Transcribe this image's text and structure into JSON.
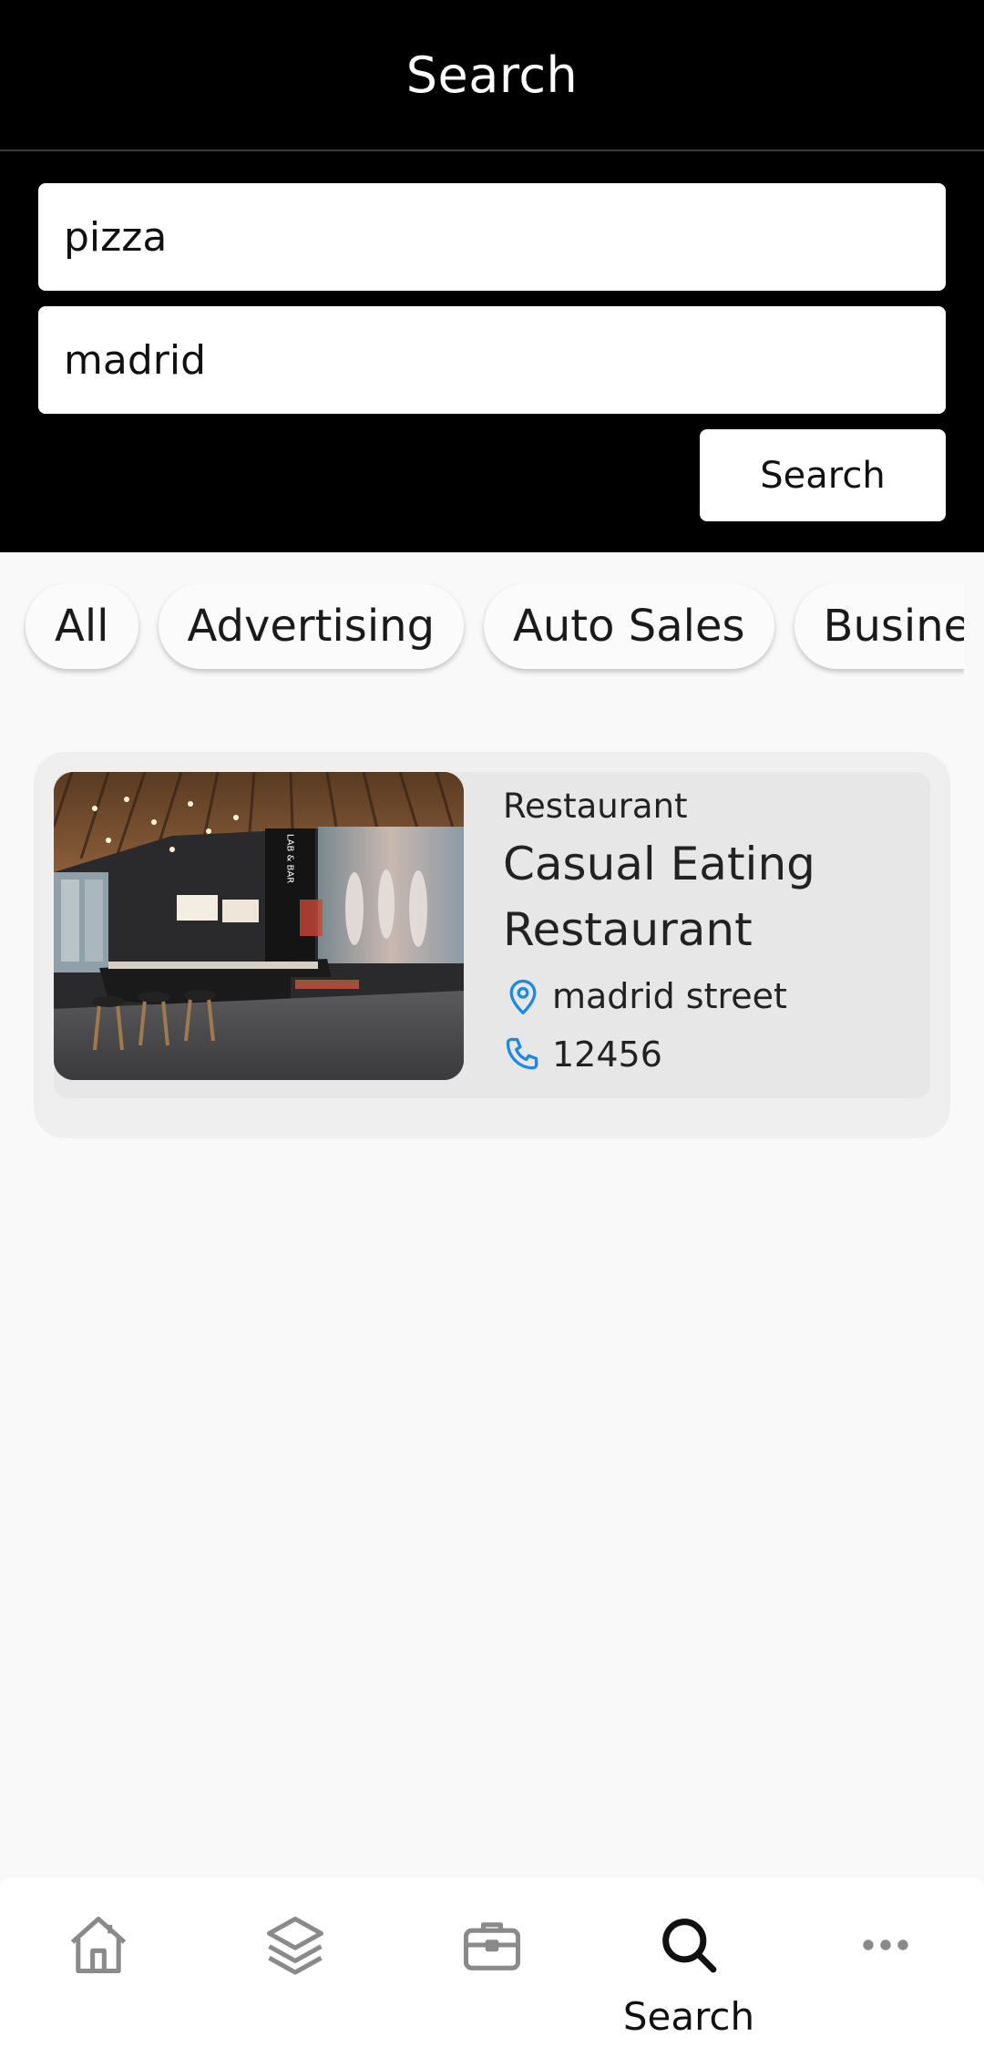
{
  "header": {
    "title": "Search"
  },
  "search": {
    "keyword_value": "pizza",
    "location_value": "madrid",
    "button_label": "Search"
  },
  "categories": [
    "All",
    "Advertising",
    "Auto Sales",
    "Business"
  ],
  "results": [
    {
      "category": "Restaurant",
      "title_line1": "Casual Eating",
      "title_line2": "Restaurant",
      "address": "madrid street",
      "phone": "12456",
      "image_sign": "LAB & BAR"
    }
  ],
  "nav": {
    "items": [
      {
        "icon": "home-icon",
        "label": ""
      },
      {
        "icon": "layers-icon",
        "label": ""
      },
      {
        "icon": "briefcase-icon",
        "label": ""
      },
      {
        "icon": "search-icon",
        "label": "Search",
        "active": true
      },
      {
        "icon": "more-icon",
        "label": ""
      }
    ]
  },
  "colors": {
    "header_bg": "#000000",
    "accent_blue": "#1e88e5",
    "nav_inactive": "#8a8a8a",
    "nav_active": "#111111"
  }
}
